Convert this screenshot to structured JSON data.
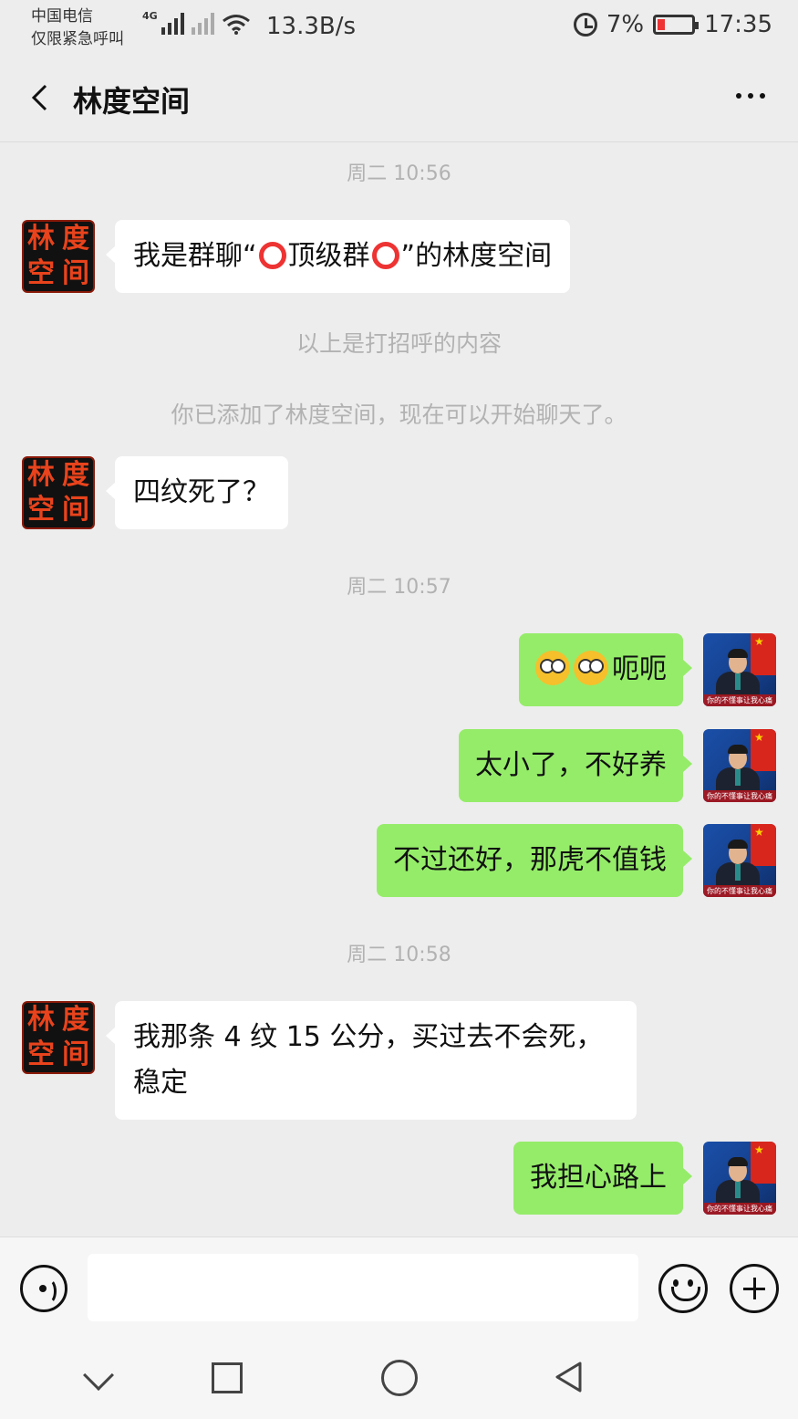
{
  "status_bar": {
    "carrier_line1": "中国电信",
    "carrier_line2": "仅限紧急呼叫",
    "network_type": "4G",
    "net_speed": "13.3B/s",
    "battery": "7%",
    "time": "17:35"
  },
  "header": {
    "title": "林度空间"
  },
  "avatars": {
    "left_chars": [
      "林",
      "度",
      "空",
      "间"
    ],
    "right_caption": "你的不懂事让我心痛"
  },
  "messages": [
    {
      "type": "time",
      "text": "周二 10:56"
    },
    {
      "type": "left",
      "text_parts": [
        "我是群聊“",
        "顶级群",
        "”的林度空间"
      ]
    },
    {
      "type": "system",
      "text": "以上是打招呼的内容"
    },
    {
      "type": "system",
      "text": "你已添加了林度空间，现在可以开始聊天了。"
    },
    {
      "type": "left",
      "text": "四纹死了？"
    },
    {
      "type": "time",
      "text": "周二 10:57"
    },
    {
      "type": "right",
      "text": "呃呃",
      "emojis": [
        "flushed-face",
        "flushed-face"
      ]
    },
    {
      "type": "right",
      "text": "太小了，不好养"
    },
    {
      "type": "right",
      "text": "不过还好，那虎不值钱"
    },
    {
      "type": "time",
      "text": "周二 10:58"
    },
    {
      "type": "left",
      "text_line1": "我那条 4 纹 15 公分，买过去不会死，",
      "text_line2": "稳定"
    },
    {
      "type": "right",
      "text": "我担心路上"
    }
  ],
  "input": {
    "value": "",
    "placeholder": ""
  },
  "icons": {
    "back": "chevron-left-icon",
    "more": "more-icon",
    "voice": "voice-icon",
    "emoji": "emoji-icon",
    "plus": "plus-icon"
  },
  "colors": {
    "bubble_self": "#95ec69",
    "bubble_other": "#ffffff",
    "background": "#ededed"
  }
}
